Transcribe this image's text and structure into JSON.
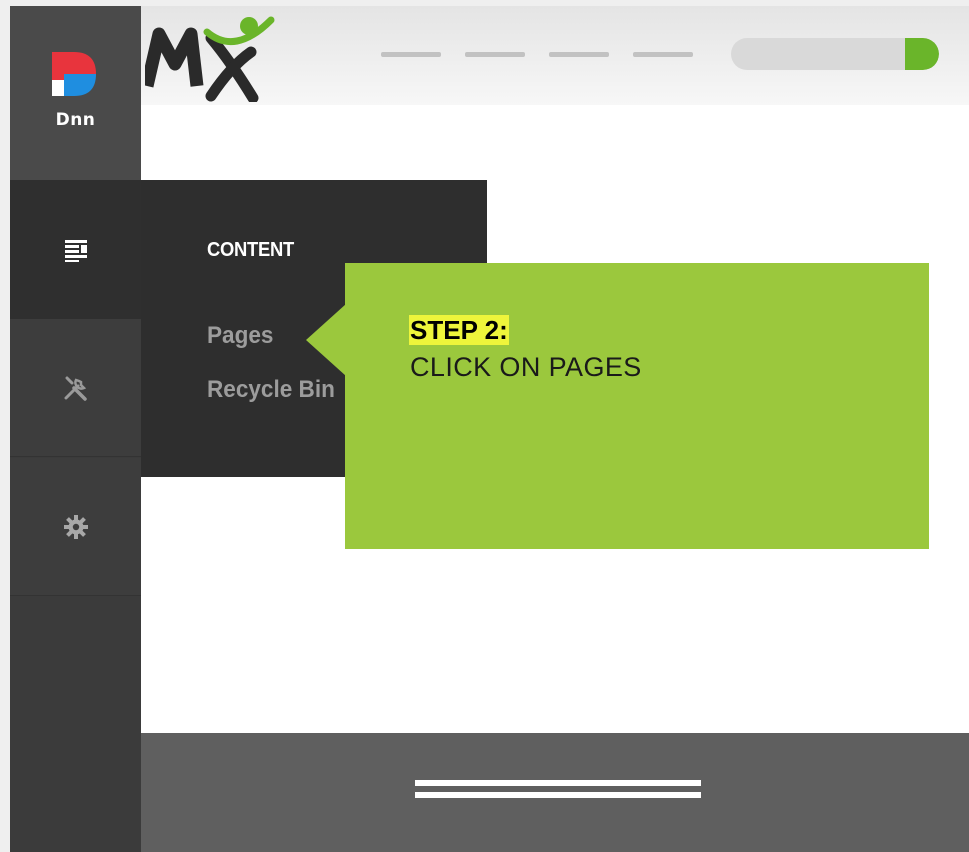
{
  "persona_bar": {
    "logo_text": "DNN",
    "logo_wordmark": "Dnn",
    "items": [
      {
        "name": "content",
        "icon": "content-lines-icon"
      },
      {
        "name": "manage",
        "icon": "wrench-screwdriver-icon"
      },
      {
        "name": "settings",
        "icon": "gear-icon"
      }
    ]
  },
  "header": {
    "logo_text": "MX",
    "search_button_color": "#6ab52a"
  },
  "flyout": {
    "title": "CONTENT",
    "links": [
      "Pages",
      "Recycle Bin"
    ]
  },
  "callout": {
    "step_label": "STEP 2:",
    "instruction": "CLICK ON PAGES",
    "background": "#9bc83d",
    "highlight": "#eef53b"
  }
}
